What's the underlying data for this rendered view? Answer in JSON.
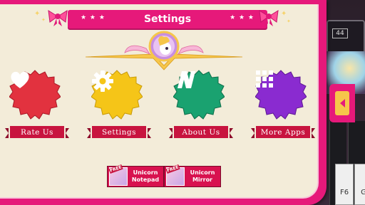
{
  "dialog": {
    "title": "Settings",
    "title_stars_left": "★ ★ ★",
    "title_stars_right": "★ ★ ★"
  },
  "buttons": [
    {
      "label": "Rate Us",
      "icon": "heart-icon",
      "color": "#e2323f"
    },
    {
      "label": "Settings",
      "icon": "gear-icon",
      "color": "#f5c518"
    },
    {
      "label": "About Us",
      "icon": "n-logo-icon",
      "color": "#1aa270"
    },
    {
      "label": "More Apps",
      "icon": "grid-icon",
      "color": "#8a2bd0"
    }
  ],
  "promos": [
    {
      "title": "Unicorn\nNotepad",
      "tag": "FREE"
    },
    {
      "title": "Unicorn\nMirror",
      "tag": "FREE"
    }
  ],
  "background_app": {
    "display_text": "44",
    "key_labels": [
      "F6",
      "G"
    ]
  },
  "colors": {
    "frame": "#e6197a",
    "panel": "#f3ecd9",
    "ribbon": "#c8143f",
    "arrow_tab": "#f6c64a"
  }
}
